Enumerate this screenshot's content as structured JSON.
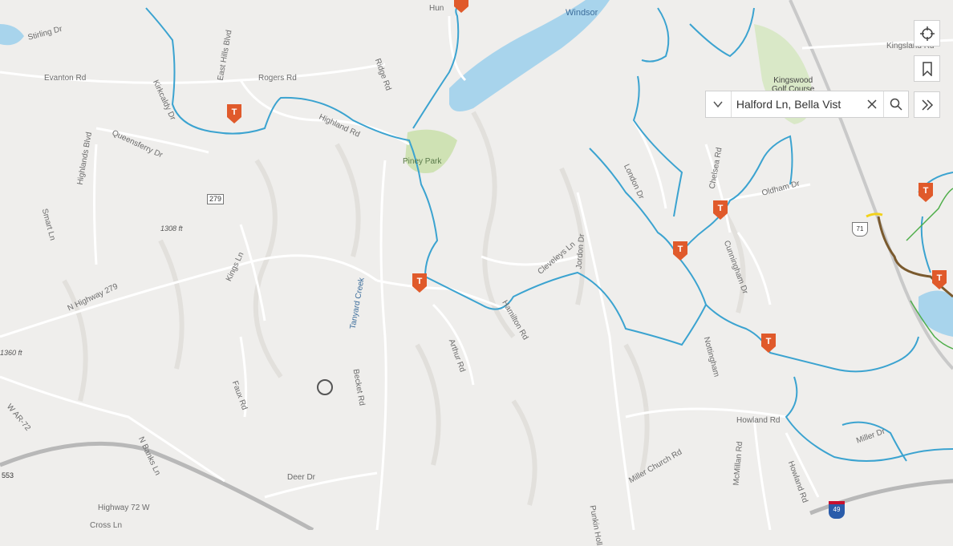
{
  "map": {
    "water_label": "Windsor",
    "roads": [
      {
        "id": "stirling",
        "label": "Stirling Dr"
      },
      {
        "id": "kirkcaldy",
        "label": "Kirkcaldy Dr"
      },
      {
        "id": "easthills",
        "label": "East Hills Blvd"
      },
      {
        "id": "evanton",
        "label": "Evanton Rd"
      },
      {
        "id": "rogers",
        "label": "Rogers Rd"
      },
      {
        "id": "ridge",
        "label": "Ridge Rd"
      },
      {
        "id": "highland",
        "label": "Highland Rd"
      },
      {
        "id": "queensferry",
        "label": "Queensferry Dr"
      },
      {
        "id": "highlandsblvd",
        "label": "Highlands Blvd"
      },
      {
        "id": "smart",
        "label": "Smart Ln"
      },
      {
        "id": "kings",
        "label": "Kings Ln"
      },
      {
        "id": "nhwy279",
        "label": "N Highway 279"
      },
      {
        "id": "tanyard",
        "label": "Tanyard Creek"
      },
      {
        "id": "becket",
        "label": "Becket Rd"
      },
      {
        "id": "faux",
        "label": "Faux Rd"
      },
      {
        "id": "wAR72",
        "label": "W AR-72"
      },
      {
        "id": "nbanks",
        "label": "N Banks Ln"
      },
      {
        "id": "deer",
        "label": "Deer Dr"
      },
      {
        "id": "hwy72w",
        "label": "Highway 72 W"
      },
      {
        "id": "cross",
        "label": "Cross Ln"
      },
      {
        "id": "arthur",
        "label": "Arthur Rd"
      },
      {
        "id": "hamilton",
        "label": "Hamilton Rd"
      },
      {
        "id": "cleveleys",
        "label": "Cleveleys Ln"
      },
      {
        "id": "jordon",
        "label": "Jordon Dr"
      },
      {
        "id": "london",
        "label": "London Dr"
      },
      {
        "id": "chelsea",
        "label": "Chelsea Rd"
      },
      {
        "id": "oldham",
        "label": "Oldham Dr"
      },
      {
        "id": "cunningham",
        "label": "Cunningham Dr"
      },
      {
        "id": "kingsland",
        "label": "Kingsland Rd"
      },
      {
        "id": "howland",
        "label": "Howland Rd"
      },
      {
        "id": "howland2",
        "label": "Howland Rd"
      },
      {
        "id": "miller",
        "label": "Miller Dr"
      },
      {
        "id": "millerchurch",
        "label": "Miller Church Rd"
      },
      {
        "id": "mcmillan",
        "label": "McMillan Rd"
      },
      {
        "id": "punkin",
        "label": "Punkin Holl"
      },
      {
        "id": "nottingham",
        "label": "Nottingham"
      },
      {
        "id": "hun",
        "label": "Hun"
      }
    ],
    "places": {
      "piney_park": "Piney Park",
      "golf": "Kingswood\nGolf Course"
    },
    "elevations": [
      "1308 ft",
      "1360 ft"
    ],
    "shields": {
      "state279": "279",
      "us71": "71",
      "i49": "49",
      "a553": "553"
    },
    "trailhead_letter": "T",
    "colors": {
      "trail": "#3ba3d0",
      "trailhead": "#e05a2b",
      "road": "#ffffff",
      "terrain": "#efeeec",
      "water": "#a8d4ec",
      "park": "#cfe2b4",
      "highway": "#b8b8b8",
      "trail_brown": "#7a5a2e",
      "trail_green": "#4fae4a",
      "trail_yellow": "#f2d21b"
    }
  },
  "controls": {
    "locate_icon": "crosshair-icon",
    "bookmark_icon": "bookmark-icon",
    "expand_icon": "double-chevron-right-icon"
  },
  "search": {
    "value": "Halford Ln, Bella Vist",
    "dropdown_icon": "triangle-down-icon",
    "clear_icon": "close-icon",
    "search_icon": "search-icon"
  }
}
